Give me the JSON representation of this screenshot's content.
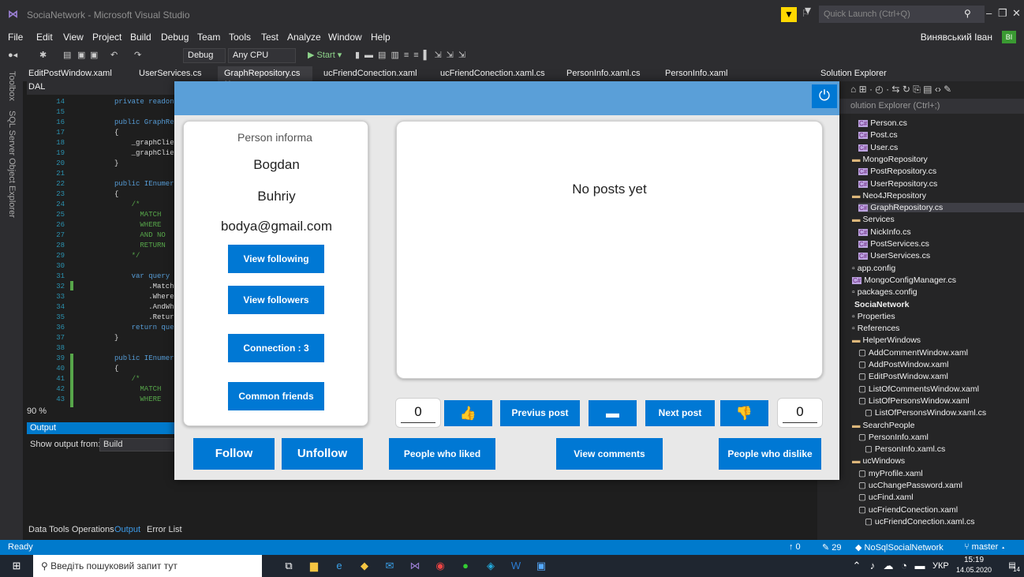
{
  "vs": {
    "title": "SociaNetwork - Microsoft Visual Studio",
    "quick_launch": "Quick Launch (Ctrl+Q)",
    "user": "Винявський Іван",
    "user_initials": "ВІ",
    "menu": [
      "File",
      "Edit",
      "View",
      "Project",
      "Build",
      "Debug",
      "Team",
      "Tools",
      "Test",
      "Analyze",
      "Window",
      "Help"
    ],
    "toolbar": {
      "config": "Debug",
      "platform": "Any CPU",
      "start": "▶ Start ▾"
    },
    "tabs": [
      "EditPostWindow.xaml",
      "UserServices.cs",
      "GraphRepository.cs",
      "ucFriendConection.xaml",
      "ucFriendConection.xaml.cs",
      "PersonInfo.xaml.cs",
      "PersonInfo.xaml"
    ],
    "rail": {
      "toolbox": "Toolbox",
      "sql": "SQL Server Object Explorer"
    },
    "nav_scope": "DAL",
    "code_lines": [
      {
        "n": "14",
        "t": "private readon"
      },
      {
        "n": "15",
        "t": ""
      },
      {
        "n": "16",
        "t": "public GraphRe"
      },
      {
        "n": "17",
        "t": "{"
      },
      {
        "n": "18",
        "t": "    _graphClie"
      },
      {
        "n": "19",
        "t": "    _graphClie"
      },
      {
        "n": "20",
        "t": "}"
      },
      {
        "n": "21",
        "t": ""
      },
      {
        "n": "22",
        "t": "public IEnumer"
      },
      {
        "n": "23",
        "t": "{"
      },
      {
        "n": "24",
        "t": "    /*"
      },
      {
        "n": "25",
        "t": "      MATCH"
      },
      {
        "n": "26",
        "t": "      WHERE"
      },
      {
        "n": "27",
        "t": "      AND NO"
      },
      {
        "n": "28",
        "t": "      RETURN"
      },
      {
        "n": "29",
        "t": "    */"
      },
      {
        "n": "30",
        "t": ""
      },
      {
        "n": "31",
        "t": "    var query"
      },
      {
        "n": "32",
        "t": "        .Match"
      },
      {
        "n": "33",
        "t": "        .Where"
      },
      {
        "n": "34",
        "t": "        .AndWh"
      },
      {
        "n": "35",
        "t": "        .Retur"
      },
      {
        "n": "36",
        "t": "    return que"
      },
      {
        "n": "37",
        "t": "}"
      },
      {
        "n": "38",
        "t": ""
      },
      {
        "n": "39",
        "t": "public IEnumer"
      },
      {
        "n": "40",
        "t": "{"
      },
      {
        "n": "41",
        "t": "    /*"
      },
      {
        "n": "42",
        "t": "      MATCH"
      },
      {
        "n": "43",
        "t": "      WHERE"
      }
    ],
    "zoom": "90 %",
    "output": {
      "title": "Output",
      "from_label": "Show output from:",
      "source": "Build"
    },
    "bottom_tabs": [
      "Data Tools Operations",
      "Output",
      "Error List"
    ],
    "solution_explorer": {
      "title": "Solution Explorer",
      "search": "olution Explorer (Ctrl+;)",
      "items": [
        {
          "label": "Person.cs",
          "kind": "cs",
          "indent": 1
        },
        {
          "label": "Post.cs",
          "kind": "cs",
          "indent": 1
        },
        {
          "label": "User.cs",
          "kind": "cs",
          "indent": 1
        },
        {
          "label": "MongoRepository",
          "kind": "folder",
          "indent": 0
        },
        {
          "label": "PostRepository.cs",
          "kind": "cs",
          "indent": 1
        },
        {
          "label": "UserRepository.cs",
          "kind": "cs",
          "indent": 1
        },
        {
          "label": "Neo4JRepository",
          "kind": "folder",
          "indent": 0
        },
        {
          "label": "GraphRepository.cs",
          "kind": "cs",
          "indent": 1,
          "selected": true
        },
        {
          "label": "Services",
          "kind": "folder",
          "indent": 0
        },
        {
          "label": "NickInfo.cs",
          "kind": "cs",
          "indent": 1
        },
        {
          "label": "PostServices.cs",
          "kind": "cs",
          "indent": 1
        },
        {
          "label": "UserServices.cs",
          "kind": "cs",
          "indent": 1
        },
        {
          "label": "app.config",
          "kind": "file",
          "indent": 0
        },
        {
          "label": "MongoConfigManager.cs",
          "kind": "cs",
          "indent": 0
        },
        {
          "label": "packages.config",
          "kind": "file",
          "indent": 0
        },
        {
          "label": "SociaNetwork",
          "kind": "project",
          "indent": 0
        },
        {
          "label": "Properties",
          "kind": "file",
          "indent": 0
        },
        {
          "label": "References",
          "kind": "file",
          "indent": 0
        },
        {
          "label": "HelperWindows",
          "kind": "folder",
          "indent": 0
        },
        {
          "label": "AddCommentWindow.xaml",
          "kind": "xaml",
          "indent": 1
        },
        {
          "label": "AddPostWindow.xaml",
          "kind": "xaml",
          "indent": 1
        },
        {
          "label": "EditPostWindow.xaml",
          "kind": "xaml",
          "indent": 1
        },
        {
          "label": "ListOfCommentsWindow.xaml",
          "kind": "xaml",
          "indent": 1
        },
        {
          "label": "ListOfPersonsWindow.xaml",
          "kind": "xaml",
          "indent": 1
        },
        {
          "label": "ListOfPersonsWindow.xaml.cs",
          "kind": "xaml",
          "indent": 2
        },
        {
          "label": "SearchPeople",
          "kind": "folder",
          "indent": 0
        },
        {
          "label": "PersonInfo.xaml",
          "kind": "xaml",
          "indent": 1
        },
        {
          "label": "PersonInfo.xaml.cs",
          "kind": "xaml",
          "indent": 2
        },
        {
          "label": "ucWindows",
          "kind": "folder",
          "indent": 0
        },
        {
          "label": "myProfile.xaml",
          "kind": "xaml",
          "indent": 1
        },
        {
          "label": "ucChangePassword.xaml",
          "kind": "xaml",
          "indent": 1
        },
        {
          "label": "ucFind.xaml",
          "kind": "xaml",
          "indent": 1
        },
        {
          "label": "ucFriendConection.xaml",
          "kind": "xaml",
          "indent": 1
        },
        {
          "label": "ucFriendConection.xaml.cs",
          "kind": "xaml",
          "indent": 2
        }
      ]
    },
    "status": {
      "ready": "Ready",
      "up": "↑ 0",
      "pencil": "✎ 29",
      "repo": "◆ NoSqlSocialNetwork",
      "branch": "⑂ master ▴"
    }
  },
  "taskbar": {
    "search_placeholder": "Введіть пошуковий запит тут",
    "lang": "УКР",
    "time": "15:19",
    "date": "14.05.2020",
    "notifications": "14"
  },
  "app": {
    "person": {
      "header": "Person informa",
      "first_name": "Bogdan",
      "last_name": "Buhriy",
      "email": "bodya@gmail.com"
    },
    "buttons": {
      "view_following": "View following",
      "view_followers": "View followers",
      "connection": "Connection : 3",
      "common_friends": "Common friends",
      "follow": "Follow",
      "unfollow": "Unfollow",
      "people_who_liked": "People who liked",
      "view_comments": "View comments",
      "people_who_dislike": "People who dislike",
      "previous_post": "Previus post",
      "next_post": "Next post"
    },
    "posts_empty": "No posts yet",
    "likes_count": "0",
    "dislikes_count": "0"
  }
}
